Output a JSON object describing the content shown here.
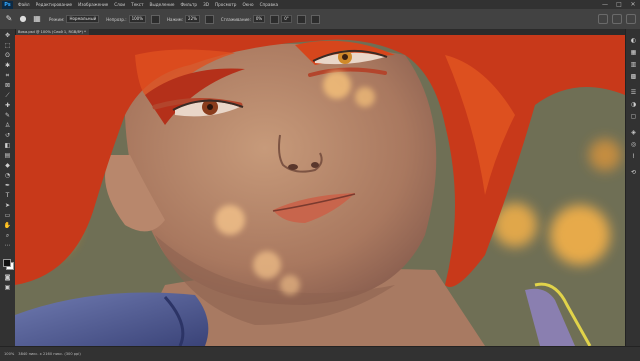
{
  "app": {
    "logo": "Ps"
  },
  "menu": {
    "items": [
      "Файл",
      "Редактирование",
      "Изображение",
      "Слои",
      "Текст",
      "Выделение",
      "Фильтр",
      "3D",
      "Просмотр",
      "Окно",
      "Справка"
    ]
  },
  "window_controls": {
    "minimize": "—",
    "maximize": "□",
    "close": "✕"
  },
  "options": {
    "mode_label": "Режим:",
    "mode_value": "Нормальный",
    "opacity_label": "Непрозр.:",
    "opacity_value": "100%",
    "flow_label": "Нажим:",
    "flow_value": "22%",
    "smoothing_label": "Сглаживание:",
    "smoothing_value": "0%",
    "angle_value": "0°"
  },
  "document": {
    "tab_title": "Вика.psd @ 100% (Слой 1, RGB/8*) *"
  },
  "status": {
    "zoom": "100%",
    "doc_info": "3840 пикс. x 2160 пикс. (300 ppi)"
  },
  "colors": {
    "hair": "#c8391a",
    "skin": "#b4876d",
    "background": "#6f6f55",
    "bokeh": "#f4b14a",
    "shirt": "#4f5c91"
  },
  "icons": {
    "tools": [
      "move-icon",
      "marquee-icon",
      "lasso-icon",
      "quick-select-icon",
      "crop-icon",
      "frame-icon",
      "eyedropper-icon",
      "healing-icon",
      "brush-icon",
      "stamp-icon",
      "history-brush-icon",
      "eraser-icon",
      "gradient-icon",
      "blur-icon",
      "dodge-icon",
      "pen-icon",
      "type-icon",
      "path-select-icon",
      "rectangle-icon",
      "hand-icon",
      "zoom-icon",
      "more-tools-icon"
    ],
    "dock": [
      "color-panel-icon",
      "swatches-icon",
      "gradients-icon",
      "patterns-icon",
      "properties-icon",
      "adjustments-icon",
      "libraries-icon",
      "layers-icon",
      "channels-icon",
      "paths-icon",
      "history-icon"
    ]
  }
}
